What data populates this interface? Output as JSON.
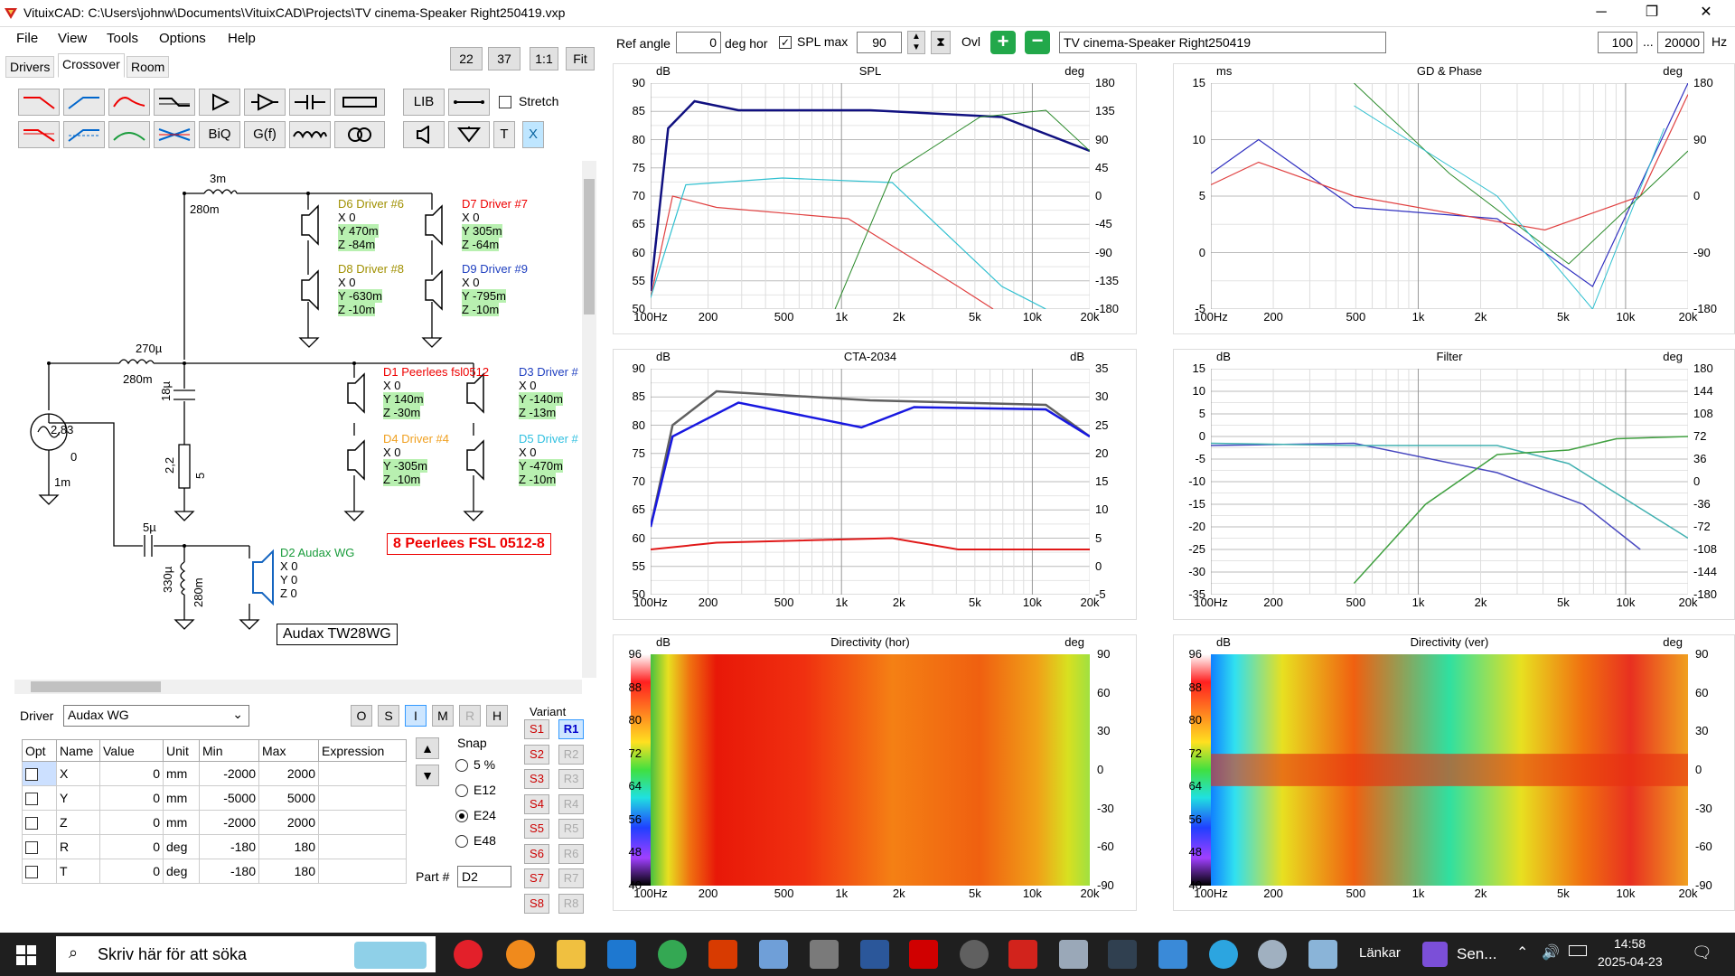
{
  "window": {
    "title": "VituixCAD: C:\\Users\\johnw\\Documents\\VituixCAD\\Projects\\TV cinema-Speaker Right250419.vxp",
    "min": "─",
    "max": "❐",
    "close": "✕"
  },
  "menu": [
    "File",
    "View",
    "Tools",
    "Options",
    "Help"
  ],
  "tabs": [
    "Drivers",
    "Crossover",
    "Room"
  ],
  "zoom": {
    "a": "22",
    "b": "37",
    "one": "1:1",
    "fit": "Fit"
  },
  "tools": {
    "lib": "LIB",
    "biq": "BiQ",
    "gf": "G(f)",
    "t": "T",
    "x": "X",
    "stretch": "Stretch"
  },
  "schematic": {
    "l1": "3m",
    "l1r": "280m",
    "l2": "270µ",
    "l2r": "280m",
    "c1": "18µ",
    "r1": "2,2",
    "r1b": "5",
    "src": "2,83",
    "src0": "0",
    "srcr": "1m",
    "c2": "5µ",
    "l3": "330µ",
    "l3r": "280m",
    "d6": {
      "name": "D6 Driver #6",
      "x": "X 0",
      "y": "Y 470m",
      "z": "Z -84m"
    },
    "d7": {
      "name": "D7 Driver #7",
      "x": "X 0",
      "y": "Y 305m",
      "z": "Z -64m"
    },
    "d8": {
      "name": "D8 Driver #8",
      "x": "X 0",
      "y": "Y -630m",
      "z": "Z -10m"
    },
    "d9": {
      "name": "D9 Driver #9",
      "x": "X 0",
      "y": "Y -795m",
      "z": "Z -10m"
    },
    "d1": {
      "name": "D1 Peerlees fsl0512",
      "x": "X 0",
      "y": "Y 140m",
      "z": "Z -30m"
    },
    "d3": {
      "name": "D3 Driver #",
      "x": "X 0",
      "y": "Y -140m",
      "z": "Z -13m"
    },
    "d4": {
      "name": "D4 Driver #4",
      "x": "X 0",
      "y": "Y -305m",
      "z": "Z -10m"
    },
    "d5": {
      "name": "D5 Driver #",
      "x": "X 0",
      "y": "Y -470m",
      "z": "Z -10m"
    },
    "d2": {
      "name": "D2 Audax WG",
      "x": "X 0",
      "y": "Y 0",
      "z": "Z 0"
    },
    "note1": "8 Peerlees FSL 0512-8",
    "note2": "Audax TW28WG"
  },
  "driver": {
    "label": "Driver",
    "value": "Audax WG",
    "btns": [
      "O",
      "S",
      "I",
      "M",
      "R",
      "H"
    ]
  },
  "table": {
    "headers": [
      "Opt",
      "Name",
      "Value",
      "Unit",
      "Min",
      "Max",
      "Expression"
    ],
    "rows": [
      [
        "X",
        "0",
        "mm",
        "-2000",
        "2000"
      ],
      [
        "Y",
        "0",
        "mm",
        "-5000",
        "5000"
      ],
      [
        "Z",
        "0",
        "mm",
        "-2000",
        "2000"
      ],
      [
        "R",
        "0",
        "deg",
        "-180",
        "180"
      ],
      [
        "T",
        "0",
        "deg",
        "-180",
        "180"
      ]
    ]
  },
  "snap": {
    "label": "Snap",
    "options": [
      "5 %",
      "E12",
      "E24",
      "E48"
    ],
    "selected": "E24"
  },
  "part": {
    "label": "Part #",
    "value": "D2"
  },
  "variant": {
    "label": "Variant",
    "s": [
      "S1",
      "S2",
      "S3",
      "S4",
      "S5",
      "S6",
      "S7",
      "S8"
    ],
    "r": [
      "R1",
      "R2",
      "R3",
      "R4",
      "R5",
      "R6",
      "R7",
      "R8"
    ]
  },
  "top": {
    "refangle_label": "Ref angle",
    "refangle": "0",
    "deghor": "deg hor",
    "splmax_label": "SPL max",
    "splmax": "90",
    "ovl": "Ovl",
    "name": "TV cinema-Speaker Right250419",
    "fmin": "100",
    "dots": "...",
    "fmax": "20000",
    "hz": "Hz"
  },
  "panels": {
    "spl": {
      "title": "SPL",
      "yl": "dB",
      "yr": "deg",
      "left": [
        "90",
        "85",
        "80",
        "75",
        "70",
        "65",
        "60",
        "55",
        "50"
      ],
      "right": [
        "180",
        "135",
        "90",
        "45",
        "0",
        "-45",
        "-90",
        "-135",
        "-180"
      ]
    },
    "gd": {
      "title": "GD & Phase",
      "yl": "ms",
      "yr": "deg",
      "left": [
        "15",
        "10",
        "5",
        "0",
        "-5"
      ],
      "right": [
        "180",
        "90",
        "0",
        "-90",
        "-180"
      ]
    },
    "cta": {
      "title": "CTA-2034",
      "yl": "dB",
      "yr": "dB",
      "left": [
        "90",
        "85",
        "80",
        "75",
        "70",
        "65",
        "60",
        "55",
        "50"
      ],
      "right": [
        "35",
        "30",
        "25",
        "20",
        "15",
        "10",
        "5",
        "0",
        "-5"
      ]
    },
    "filter": {
      "title": "Filter",
      "yl": "dB",
      "yr": "deg",
      "left": [
        "15",
        "10",
        "5",
        "0",
        "-5",
        "-10",
        "-15",
        "-20",
        "-25",
        "-30",
        "-35"
      ],
      "right": [
        "180",
        "144",
        "108",
        "72",
        "36",
        "0",
        "-36",
        "-72",
        "-108",
        "-144",
        "-180"
      ]
    },
    "dh": {
      "title": "Directivity (hor)",
      "yl": "dB",
      "yr": "deg",
      "scale": [
        "96",
        "88",
        "80",
        "72",
        "64",
        "56",
        "48",
        "40"
      ],
      "right": [
        "90",
        "60",
        "30",
        "0",
        "-30",
        "-60",
        "-90"
      ]
    },
    "dv": {
      "title": "Directivity (ver)",
      "yl": "dB",
      "yr": "deg",
      "scale": [
        "96",
        "88",
        "80",
        "72",
        "64",
        "56",
        "48",
        "40"
      ],
      "right": [
        "90",
        "60",
        "30",
        "0",
        "-30",
        "-60",
        "-90"
      ]
    },
    "xticks": [
      "100Hz",
      "200",
      "500",
      "1k",
      "2k",
      "5k",
      "10k",
      "20k"
    ]
  },
  "taskbar": {
    "search": "Skriv här för att söka",
    "links": "Länkar",
    "sen": "Sen...",
    "time": "14:58",
    "date": "2025-04-23"
  }
}
